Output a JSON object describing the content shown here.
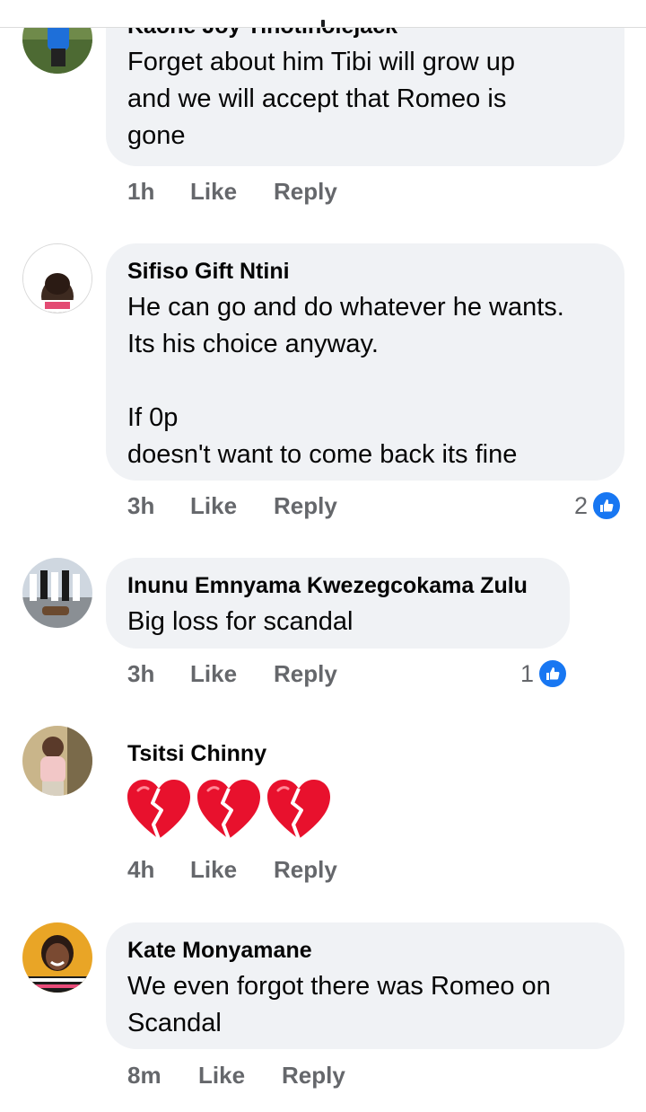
{
  "comments": [
    {
      "author": "Kaone Joy Tinotinolejack",
      "text": "Forget about him Tibi will grow up\nand we will accept that Romeo is\ngone",
      "time": "1h",
      "like_label": "Like",
      "reply_label": "Reply",
      "reactions": ""
    },
    {
      "author": "Sifiso Gift Ntini",
      "text": "He can go and do whatever he wants.\nIts his choice anyway.\n\nIf 0p\ndoesn't want to come back its fine",
      "time": "3h",
      "like_label": "Like",
      "reply_label": "Reply",
      "reactions": "2"
    },
    {
      "author": "Inunu Emnyama Kwezegcokama Zulu",
      "text": "Big loss for scandal",
      "time": "3h",
      "like_label": "Like",
      "reply_label": "Reply",
      "reactions": "1"
    },
    {
      "author": "Tsitsi Chinny",
      "emojis": [
        "broken-heart-icon",
        "broken-heart-icon",
        "broken-heart-icon"
      ],
      "time": "4h",
      "like_label": "Like",
      "reply_label": "Reply",
      "reactions": ""
    },
    {
      "author": "Kate Monyamane",
      "text": "We even forgot there was Romeo on\nScandal",
      "time": "8m",
      "like_label": "Like",
      "reply_label": "Reply",
      "reactions": ""
    }
  ],
  "colors": {
    "bubble": "#f0f2f5",
    "meta_text": "#65676b",
    "like_blue": "#1877f2",
    "broken_heart": "#e8112d"
  },
  "icons": {
    "reaction": "thumbs-up-icon"
  }
}
